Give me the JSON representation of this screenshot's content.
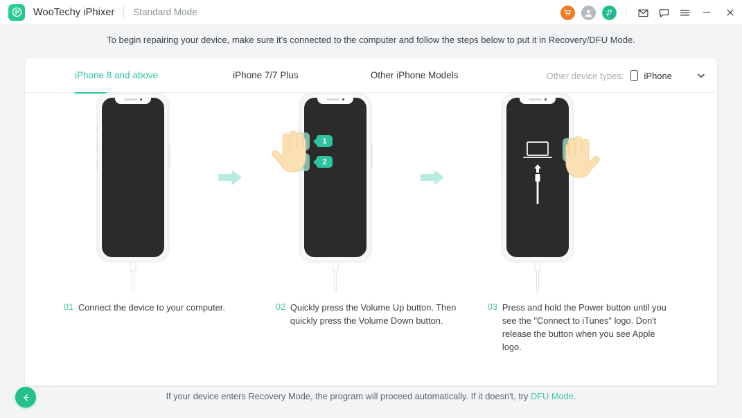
{
  "titlebar": {
    "app_name": "WooTechy iPhixer",
    "mode": "Standard Mode",
    "icons": {
      "cart": "cart-icon",
      "account": "account-icon",
      "music": "music-search-icon",
      "mail": "mail-icon",
      "feedback": "feedback-icon",
      "menu": "hamburger-menu-icon",
      "minimize": "minimize-icon",
      "close": "close-icon"
    }
  },
  "instruction": "To begin repairing your device, make sure it's connected to the computer and follow the steps below to put it in Recovery/DFU Mode.",
  "tabs": [
    {
      "label": "iPhone 8 and above",
      "active": true
    },
    {
      "label": "iPhone 7/7 Plus",
      "active": false
    },
    {
      "label": "Other iPhone Models",
      "active": false
    }
  ],
  "device_type": {
    "label": "Other device types:",
    "value": "iPhone"
  },
  "badges": {
    "one": "1",
    "two": "2"
  },
  "steps": [
    {
      "num": "01",
      "text": "Connect the device to your computer."
    },
    {
      "num": "02",
      "text": "Quickly press the Volume Up button. Then quickly press the Volume Down button."
    },
    {
      "num": "03",
      "text": "Press and hold the Power button until you see the \"Connect to iTunes\" logo. Don't release the button when you see Apple logo."
    }
  ],
  "footer": {
    "text": "If your device enters Recovery Mode, the program will proceed automatically. If it doesn't, try ",
    "link": "DFU Mode",
    "suffix": ".",
    "back_button": "back-button"
  },
  "colors": {
    "accent": "#2ec49e",
    "accent_dark": "#22c08c",
    "arrow": "#b8ece0",
    "cart": "#f07c28",
    "avatar": "#b4bcc2",
    "screen": "#2b2b2b"
  }
}
